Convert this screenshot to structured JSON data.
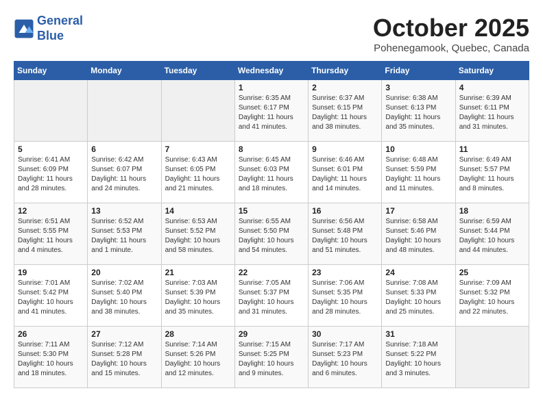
{
  "header": {
    "logo_line1": "General",
    "logo_line2": "Blue",
    "month_title": "October 2025",
    "location": "Pohenegamook, Quebec, Canada"
  },
  "days_of_week": [
    "Sunday",
    "Monday",
    "Tuesday",
    "Wednesday",
    "Thursday",
    "Friday",
    "Saturday"
  ],
  "weeks": [
    [
      {
        "day": "",
        "info": ""
      },
      {
        "day": "",
        "info": ""
      },
      {
        "day": "",
        "info": ""
      },
      {
        "day": "1",
        "info": "Sunrise: 6:35 AM\nSunset: 6:17 PM\nDaylight: 11 hours\nand 41 minutes."
      },
      {
        "day": "2",
        "info": "Sunrise: 6:37 AM\nSunset: 6:15 PM\nDaylight: 11 hours\nand 38 minutes."
      },
      {
        "day": "3",
        "info": "Sunrise: 6:38 AM\nSunset: 6:13 PM\nDaylight: 11 hours\nand 35 minutes."
      },
      {
        "day": "4",
        "info": "Sunrise: 6:39 AM\nSunset: 6:11 PM\nDaylight: 11 hours\nand 31 minutes."
      }
    ],
    [
      {
        "day": "5",
        "info": "Sunrise: 6:41 AM\nSunset: 6:09 PM\nDaylight: 11 hours\nand 28 minutes."
      },
      {
        "day": "6",
        "info": "Sunrise: 6:42 AM\nSunset: 6:07 PM\nDaylight: 11 hours\nand 24 minutes."
      },
      {
        "day": "7",
        "info": "Sunrise: 6:43 AM\nSunset: 6:05 PM\nDaylight: 11 hours\nand 21 minutes."
      },
      {
        "day": "8",
        "info": "Sunrise: 6:45 AM\nSunset: 6:03 PM\nDaylight: 11 hours\nand 18 minutes."
      },
      {
        "day": "9",
        "info": "Sunrise: 6:46 AM\nSunset: 6:01 PM\nDaylight: 11 hours\nand 14 minutes."
      },
      {
        "day": "10",
        "info": "Sunrise: 6:48 AM\nSunset: 5:59 PM\nDaylight: 11 hours\nand 11 minutes."
      },
      {
        "day": "11",
        "info": "Sunrise: 6:49 AM\nSunset: 5:57 PM\nDaylight: 11 hours\nand 8 minutes."
      }
    ],
    [
      {
        "day": "12",
        "info": "Sunrise: 6:51 AM\nSunset: 5:55 PM\nDaylight: 11 hours\nand 4 minutes."
      },
      {
        "day": "13",
        "info": "Sunrise: 6:52 AM\nSunset: 5:53 PM\nDaylight: 11 hours\nand 1 minute."
      },
      {
        "day": "14",
        "info": "Sunrise: 6:53 AM\nSunset: 5:52 PM\nDaylight: 10 hours\nand 58 minutes."
      },
      {
        "day": "15",
        "info": "Sunrise: 6:55 AM\nSunset: 5:50 PM\nDaylight: 10 hours\nand 54 minutes."
      },
      {
        "day": "16",
        "info": "Sunrise: 6:56 AM\nSunset: 5:48 PM\nDaylight: 10 hours\nand 51 minutes."
      },
      {
        "day": "17",
        "info": "Sunrise: 6:58 AM\nSunset: 5:46 PM\nDaylight: 10 hours\nand 48 minutes."
      },
      {
        "day": "18",
        "info": "Sunrise: 6:59 AM\nSunset: 5:44 PM\nDaylight: 10 hours\nand 44 minutes."
      }
    ],
    [
      {
        "day": "19",
        "info": "Sunrise: 7:01 AM\nSunset: 5:42 PM\nDaylight: 10 hours\nand 41 minutes."
      },
      {
        "day": "20",
        "info": "Sunrise: 7:02 AM\nSunset: 5:40 PM\nDaylight: 10 hours\nand 38 minutes."
      },
      {
        "day": "21",
        "info": "Sunrise: 7:03 AM\nSunset: 5:39 PM\nDaylight: 10 hours\nand 35 minutes."
      },
      {
        "day": "22",
        "info": "Sunrise: 7:05 AM\nSunset: 5:37 PM\nDaylight: 10 hours\nand 31 minutes."
      },
      {
        "day": "23",
        "info": "Sunrise: 7:06 AM\nSunset: 5:35 PM\nDaylight: 10 hours\nand 28 minutes."
      },
      {
        "day": "24",
        "info": "Sunrise: 7:08 AM\nSunset: 5:33 PM\nDaylight: 10 hours\nand 25 minutes."
      },
      {
        "day": "25",
        "info": "Sunrise: 7:09 AM\nSunset: 5:32 PM\nDaylight: 10 hours\nand 22 minutes."
      }
    ],
    [
      {
        "day": "26",
        "info": "Sunrise: 7:11 AM\nSunset: 5:30 PM\nDaylight: 10 hours\nand 18 minutes."
      },
      {
        "day": "27",
        "info": "Sunrise: 7:12 AM\nSunset: 5:28 PM\nDaylight: 10 hours\nand 15 minutes."
      },
      {
        "day": "28",
        "info": "Sunrise: 7:14 AM\nSunset: 5:26 PM\nDaylight: 10 hours\nand 12 minutes."
      },
      {
        "day": "29",
        "info": "Sunrise: 7:15 AM\nSunset: 5:25 PM\nDaylight: 10 hours\nand 9 minutes."
      },
      {
        "day": "30",
        "info": "Sunrise: 7:17 AM\nSunset: 5:23 PM\nDaylight: 10 hours\nand 6 minutes."
      },
      {
        "day": "31",
        "info": "Sunrise: 7:18 AM\nSunset: 5:22 PM\nDaylight: 10 hours\nand 3 minutes."
      },
      {
        "day": "",
        "info": ""
      }
    ]
  ]
}
